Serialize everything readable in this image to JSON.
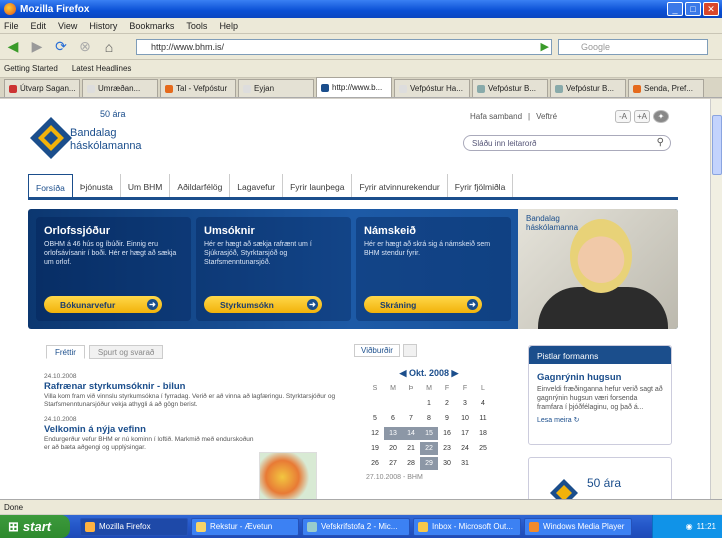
{
  "window": {
    "title": "Mozilla Firefox"
  },
  "menu": [
    "File",
    "Edit",
    "View",
    "History",
    "Bookmarks",
    "Tools",
    "Help"
  ],
  "url": "http://www.bhm.is/",
  "search_placeholder": "Google",
  "bookmarks": [
    "Getting Started",
    "Latest Headlines"
  ],
  "browser_tabs": [
    "Útvarp Sagan...",
    "Umræðan...",
    "Tal - Vefpóstur",
    "Eyjan",
    "http://www.b...",
    "Vefpóstur Ha...",
    "Vefpóstur B...",
    "Vefpóstur B...",
    "Senda, Pref..."
  ],
  "header": {
    "logo_years": "50 ára",
    "logo_line1": "Bandalag",
    "logo_line2": "háskólamanna",
    "link_login": "Hafa samband",
    "link_sep": "|",
    "link_help": "Veftré",
    "font_minus": "-A",
    "font_plus": "+A",
    "search_placeholder": "Sláðu inn leitarorð"
  },
  "nav": [
    "Forsíða",
    "Þjónusta",
    "Um BHM",
    "Aðildarfélög",
    "Lagavefur",
    "Fyrir launþega",
    "Fyrir atvinnurekendur",
    "Fyrir fjölmiðla"
  ],
  "banner": {
    "panels": [
      {
        "title": "Orlofssjóður",
        "text": "OBHM á 46 hús og íbúðir. Einnig eru orlofsávísanir í boði. Hér er hægt að sækja um orlof.",
        "button": "Bókunarvefur"
      },
      {
        "title": "Umsóknir",
        "text": "Hér er hægt að sækja rafrænt um í Sjúkrasjóð, Styrktarsjóð og Starfsmenntunarsjóð.",
        "button": "Styrkumsókn"
      },
      {
        "title": "Námskeið",
        "text": "Hér er hægt að skrá sig á námskeið sem BHM stendur fyrir.",
        "button": "Skráning"
      }
    ],
    "photo_logo1": "Bandalag",
    "photo_logo2": "háskólamanna"
  },
  "content": {
    "tab_news": "Fréttir",
    "tab_qa": "Spurt og svarað",
    "news": [
      {
        "date": "24.10.2008",
        "title": "Rafrænar styrkumsóknir - bilun",
        "body": "Villa kom fram við vinnslu styrkumsókna í fyrradag. Verið er að vinna að lagfæringu. Styrktarsjóður og Starfsmenntunarsjóður vekja athygli á að gögn berist."
      },
      {
        "date": "24.10.2008",
        "title": "Velkomin á nýja vefinn",
        "body": "Endurgerður vefur BHM er nú kominn í loftið. Markmið með endurskoðun er að bæta aðgengi og upplýsingar."
      }
    ]
  },
  "calendar": {
    "tab_events": "Viðburðir",
    "tab_other": "",
    "month": "Okt. 2008",
    "days": [
      "S",
      "M",
      "Þ",
      "M",
      "F",
      "F",
      "L"
    ],
    "cells": [
      "",
      "",
      "",
      "1",
      "2",
      "3",
      "4",
      "5",
      "6",
      "7",
      "8",
      "9",
      "10",
      "11",
      "12",
      "13",
      "14",
      "15",
      "16",
      "17",
      "18",
      "19",
      "20",
      "21",
      "22",
      "23",
      "24",
      "25",
      "26",
      "27",
      "28",
      "29",
      "30",
      "31",
      ""
    ],
    "footer": "27.10.2008 - BHM"
  },
  "sidebar": {
    "box_header": "Pistlar formanns",
    "box_title": "Gagnrýnin hugsun",
    "box_text": "Einveldi fræðinganna hefur verið sagt að gagnrýnin hugsun væri forsenda framfara í þjóðfélaginu, og það á...",
    "box_more": "Lesa meira",
    "logo2_years": "50 ára"
  },
  "statusbar": "Done",
  "taskbar": {
    "start": "start",
    "tasks": [
      "Mozilla Firefox",
      "Rekstur - Ævetun",
      "Vefskrifstofa 2 - Mic...",
      "Inbox - Microsoft Out...",
      "Windows Media Player"
    ],
    "clock": "11:21"
  },
  "colors": {
    "brand": "#1b4e8c",
    "button": "#f2b20a"
  }
}
